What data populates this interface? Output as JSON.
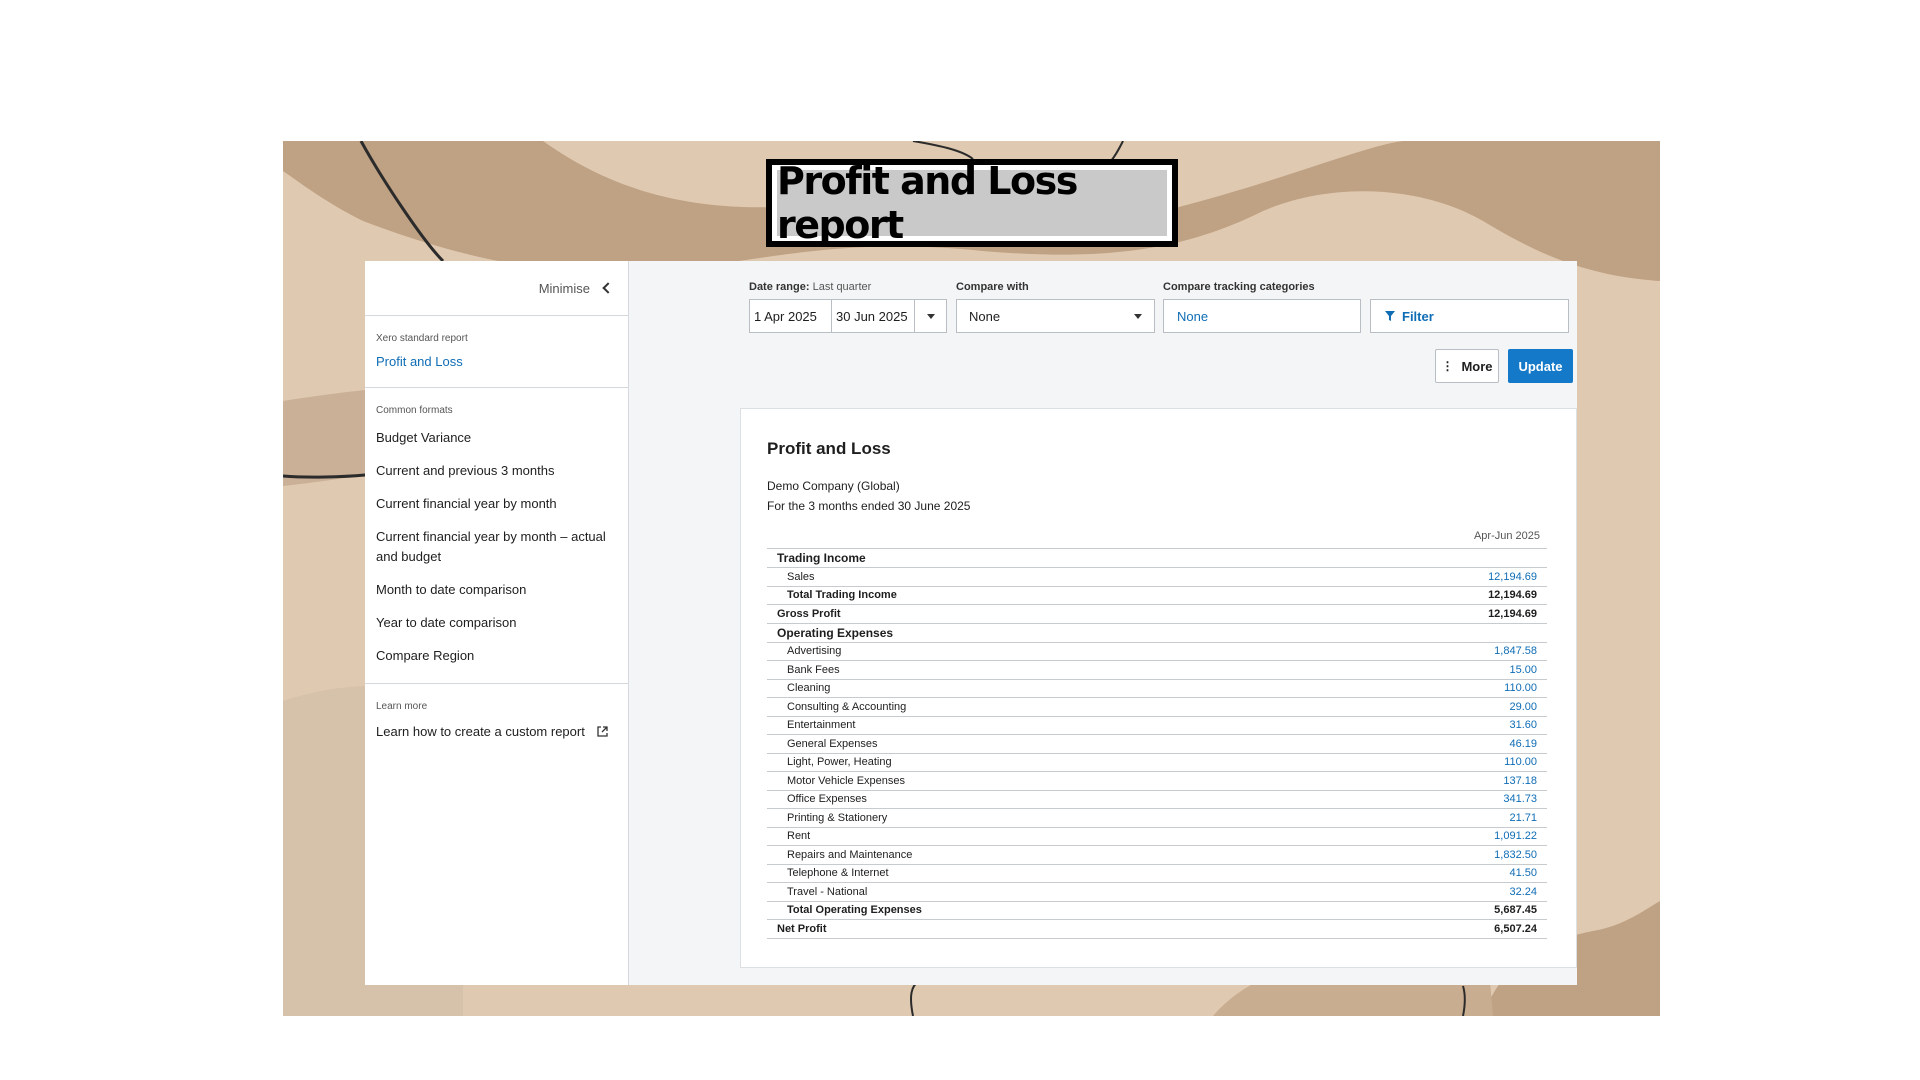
{
  "slide_title": "Profit and Loss report",
  "sidebar": {
    "minimise_label": "Minimise",
    "standard_label": "Xero standard report",
    "standard_link": "Profit and Loss",
    "formats_label": "Common formats",
    "formats": [
      "Budget Variance",
      "Current and previous 3 months",
      "Current financial year by month",
      "Current financial year by month – actual and budget",
      "Month to date comparison",
      "Year to date comparison",
      "Compare Region"
    ],
    "learn_label": "Learn more",
    "learn_link": "Learn how to create a custom report"
  },
  "filters": {
    "date_range_label": "Date range:",
    "date_range_preset": "Last quarter",
    "start_date": "1 Apr 2025",
    "end_date": "30 Jun 2025",
    "compare_with_label": "Compare with",
    "compare_with_value": "None",
    "tracking_label": "Compare tracking categories",
    "tracking_value": "None",
    "filter_label": "Filter",
    "more_label": "More",
    "update_label": "Update"
  },
  "report": {
    "title": "Profit and Loss",
    "company": "Demo Company (Global)",
    "period": "For the 3 months ended 30 June 2025",
    "column_header": "Apr-Jun 2025",
    "trading_income_heading": "Trading Income",
    "sales_label": "Sales",
    "sales_value": "12,194.69",
    "total_trading_income_label": "Total Trading Income",
    "total_trading_income_value": "12,194.69",
    "gross_profit_label": "Gross Profit",
    "gross_profit_value": "12,194.69",
    "operating_expenses_heading": "Operating Expenses",
    "expenses": [
      {
        "label": "Advertising",
        "value": "1,847.58"
      },
      {
        "label": "Bank Fees",
        "value": "15.00"
      },
      {
        "label": "Cleaning",
        "value": "110.00"
      },
      {
        "label": "Consulting & Accounting",
        "value": "29.00"
      },
      {
        "label": "Entertainment",
        "value": "31.60"
      },
      {
        "label": "General Expenses",
        "value": "46.19"
      },
      {
        "label": "Light, Power, Heating",
        "value": "110.00"
      },
      {
        "label": "Motor Vehicle Expenses",
        "value": "137.18"
      },
      {
        "label": "Office Expenses",
        "value": "341.73"
      },
      {
        "label": "Printing & Stationery",
        "value": "21.71"
      },
      {
        "label": "Rent",
        "value": "1,091.22"
      },
      {
        "label": "Repairs and Maintenance",
        "value": "1,832.50"
      },
      {
        "label": "Telephone & Internet",
        "value": "41.50"
      },
      {
        "label": "Travel - National",
        "value": "32.24"
      }
    ],
    "total_operating_expenses_label": "Total Operating Expenses",
    "total_operating_expenses_value": "5,687.45",
    "net_profit_label": "Net Profit",
    "net_profit_value": "6,507.24"
  },
  "colors": {
    "accent": "#0f6db5",
    "update_button": "#1479c8",
    "slide_bg": "#dfc9b0"
  }
}
